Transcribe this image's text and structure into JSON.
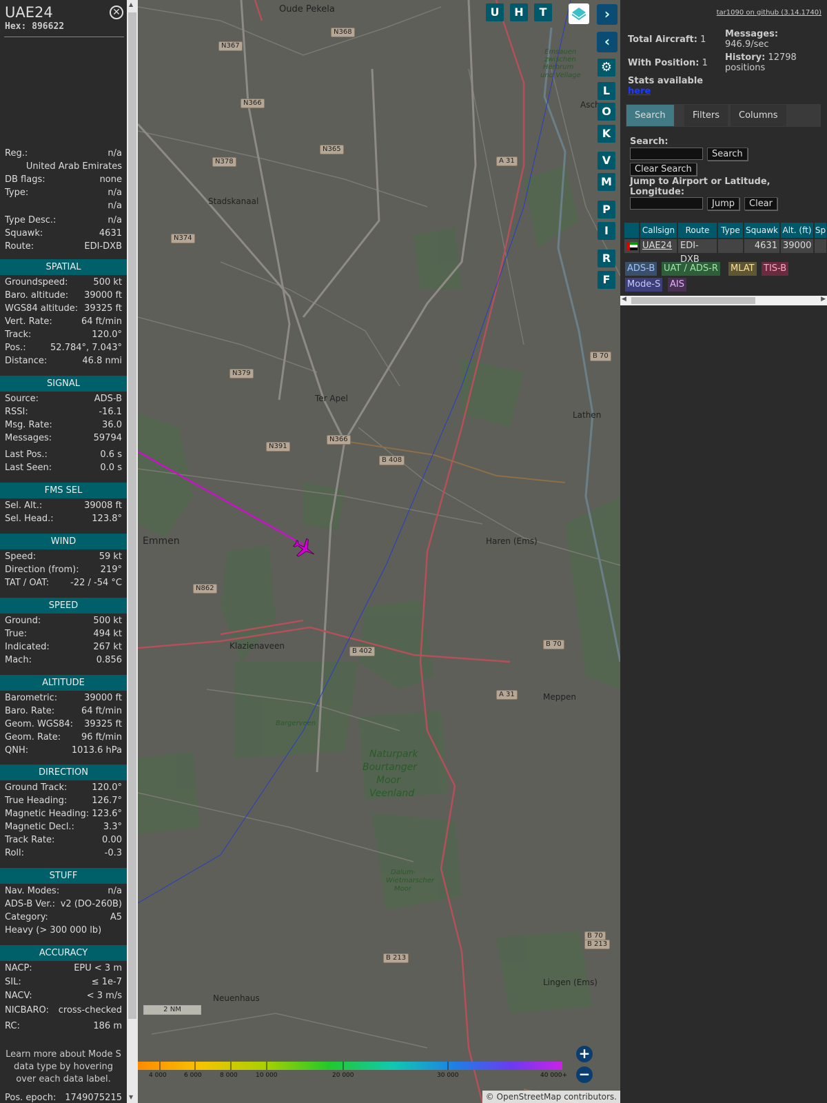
{
  "sidebar": {
    "title": "UAE24",
    "hex": "Hex: 896622",
    "info": [
      {
        "k": "Reg.:",
        "v": "n/a"
      },
      {
        "k": "",
        "v": "United Arab Emirates"
      },
      {
        "k": "DB flags:",
        "v": "none"
      },
      {
        "k": "Type:",
        "v": "n/a"
      },
      {
        "k": "",
        "v": "n/a"
      },
      {
        "k": "Type Desc.:",
        "v": "n/a"
      },
      {
        "k": "Squawk:",
        "v": "4631"
      },
      {
        "k": "Route:",
        "v": "EDI-DXB"
      }
    ],
    "sections": {
      "spatial": "SPATIAL",
      "signal": "SIGNAL",
      "fms": "FMS SEL",
      "wind": "WIND",
      "speed": "SPEED",
      "altitude": "ALTITUDE",
      "direction": "DIRECTION",
      "stuff": "STUFF",
      "accuracy": "ACCURACY"
    },
    "spatial": [
      {
        "k": "Groundspeed:",
        "v": "500 kt"
      },
      {
        "k": "Baro. altitude:",
        "v": "39000 ft"
      },
      {
        "k": "WGS84 altitude:",
        "v": "39325 ft"
      },
      {
        "k": "Vert. Rate:",
        "v": "64 ft/min"
      },
      {
        "k": "Track:",
        "v": "120.0°"
      },
      {
        "k": "Pos.:",
        "v": "52.784°, 7.043°"
      },
      {
        "k": "Distance:",
        "v": "46.8 nmi"
      }
    ],
    "signal": [
      {
        "k": "Source:",
        "v": "ADS-B"
      },
      {
        "k": "RSSI:",
        "v": "-16.1"
      },
      {
        "k": "Msg. Rate:",
        "v": "36.0"
      },
      {
        "k": "Messages:",
        "v": "59794"
      },
      {
        "k": "Last Pos.:",
        "v": "0.6 s"
      },
      {
        "k": "Last Seen:",
        "v": "0.0 s"
      }
    ],
    "fms": [
      {
        "k": "Sel. Alt.:",
        "v": "39008 ft"
      },
      {
        "k": "Sel. Head.:",
        "v": "123.8°"
      }
    ],
    "wind": [
      {
        "k": "Speed:",
        "v": "59 kt"
      },
      {
        "k": "Direction (from):",
        "v": "219°"
      },
      {
        "k": "TAT / OAT:",
        "v": "-22 / -54 °C"
      }
    ],
    "speed": [
      {
        "k": "Ground:",
        "v": "500 kt"
      },
      {
        "k": "True:",
        "v": "494 kt"
      },
      {
        "k": "Indicated:",
        "v": "267 kt"
      },
      {
        "k": "Mach:",
        "v": "0.856"
      }
    ],
    "altitude": [
      {
        "k": "Barometric:",
        "v": "39000 ft"
      },
      {
        "k": "Baro. Rate:",
        "v": "64 ft/min"
      },
      {
        "k": "Geom. WGS84:",
        "v": "39325 ft"
      },
      {
        "k": "Geom. Rate:",
        "v": "96 ft/min"
      },
      {
        "k": "QNH:",
        "v": "1013.6 hPa"
      }
    ],
    "direction": [
      {
        "k": "Ground Track:",
        "v": "120.0°"
      },
      {
        "k": "True Heading:",
        "v": "126.7°"
      },
      {
        "k": "Magnetic Heading:",
        "v": "123.6°"
      },
      {
        "k": "Magnetic Decl.:",
        "v": "3.3°"
      },
      {
        "k": "Track Rate:",
        "v": "0.00"
      },
      {
        "k": "Roll:",
        "v": "-0.3"
      }
    ],
    "stuff": [
      {
        "k": "Nav. Modes:",
        "v": "n/a"
      },
      {
        "k": "ADS-B Ver.:",
        "v": "v2 (DO-260B)"
      },
      {
        "k": "Category:",
        "v": "A5"
      },
      {
        "k": "Heavy (> 300 000 lb)",
        "v": ""
      }
    ],
    "accuracy": [
      {
        "k": "NACP:",
        "v": "EPU < 3 m"
      },
      {
        "k": "SIL:",
        "v": "≤ 1e-7"
      },
      {
        "k": "NACV:",
        "v": "< 3 m/s"
      },
      {
        "k": "NICBARO:",
        "v": "cross-checked"
      },
      {
        "k": "RC:",
        "v": "186 m"
      }
    ],
    "note": "Learn more about Mode S data type by hovering over each data label.",
    "epoch_k": "Pos. epoch:",
    "epoch_v": "1749075215"
  },
  "map": {
    "buttons_top": [
      "U",
      "H",
      "T"
    ],
    "side_buttons": [
      "L",
      "O",
      "K",
      "V",
      "M",
      "P",
      "I",
      "R",
      "F"
    ],
    "places": [
      "Oude Pekela",
      "Stadskanaal",
      "Ter Apel",
      "Emmen",
      "Klazienaveen",
      "Haren (Ems)",
      "Lathen",
      "Meppen",
      "Lingen (Ems)",
      "Neuenhaus",
      "Naturpark",
      "Bourtanger",
      "Moor",
      "Veenland",
      "Bargerveen",
      "Dalum-",
      "Wietmarscher",
      "Moor",
      "Emsauen",
      "zwischen",
      "Herbrum",
      "und Vellage",
      "Ascho"
    ],
    "roads": [
      "N368",
      "N367",
      "N366",
      "N365",
      "N378",
      "N374",
      "N379",
      "N391",
      "N366",
      "B 408",
      "N862",
      "B 402",
      "A 31",
      "A 31",
      "B 70",
      "B 70",
      "B 70",
      "B 213",
      "B 213"
    ],
    "colorbar_ticks": [
      "4 000",
      "6 000",
      "8 000",
      "10 000",
      "20 000",
      "30 000",
      "40 000+"
    ],
    "scale": "2 NM",
    "attribution_prefix": "© ",
    "attribution_link": "OpenStreetMap",
    "attribution_suffix": " contributors."
  },
  "right": {
    "github": "tar1090 on github (3.14.1740)",
    "total_k": "Total Aircraft:",
    "total_v": "1",
    "withpos_k": "With Position:",
    "withpos_v": "1",
    "messages_k": "Messages:",
    "messages_v": "946.9/sec",
    "history_k": "History:",
    "history_v": "12798 positions",
    "stats_text": "Stats available",
    "stats_link": "here",
    "tabs": [
      "Search",
      "Filters",
      "Columns"
    ],
    "search_label": "Search:",
    "search_button": "Search",
    "clear_search_button": "Clear Search",
    "jump_label": "Jump to Airport or Latitude, Longitude:",
    "jump_button": "Jump",
    "clear_button": "Clear",
    "table": {
      "headers": [
        "Callsign",
        "Route",
        "Type",
        "Squawk",
        "Alt. (ft)",
        "Sp"
      ],
      "row": {
        "callsign": "UAE24",
        "route": "EDI-DXB",
        "type": "",
        "squawk": "4631",
        "alt": "39000"
      }
    },
    "chips": [
      {
        "label": "ADS-B",
        "color": "#3a4f6a"
      },
      {
        "label": "UAT / ADS-R",
        "color": "#2e5e3a"
      },
      {
        "label": "MLAT",
        "color": "#5f5633"
      },
      {
        "label": "TIS-B",
        "color": "#6a2a3f"
      },
      {
        "label": "Mode-S",
        "color": "#3c3f7a"
      },
      {
        "label": "AIS",
        "color": "#4a2f55"
      }
    ]
  }
}
